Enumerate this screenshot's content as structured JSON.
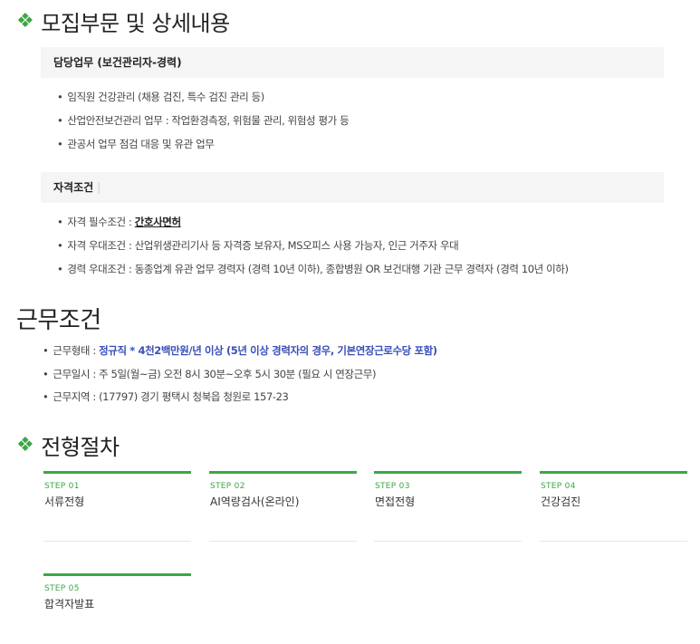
{
  "section_recruit": {
    "icon": "diamond-icon",
    "title": "모집부문 및 상세내용",
    "duty": {
      "header": "담당업무 (보건관리자-경력)",
      "items": [
        "임직원 건강관리 (채용 검진, 특수 검진 관리 등)",
        "산업안전보건관리 업무 : 작업환경측정, 위험물 관리, 위험성 평가 등",
        "관공서 업무 점검 대응 및 유관 업무"
      ]
    },
    "qualification": {
      "header": "자격조건",
      "required_label": "자격 필수조건 : ",
      "required_value": "간호사면허",
      "preferred": "자격 우대조건 : 산업위생관리기사 등 자격증 보유자, MS오피스 사용 가능자, 인근 거주자 우대",
      "career": "경력 우대조건 : 동종업계 유관 업무 경력자 (경력 10년 이하), 종합병원 OR 보건대행 기관 근무 경력자 (경력 10년 이하)"
    }
  },
  "section_conditions": {
    "title": "근무조건",
    "type_label": "근무형태 : ",
    "type_value": "정규직   *  4천2백만원/년 이상 (5년 이상 경력자의 경우, 기본연장근로수당 포함)",
    "schedule": "근무일시 : 주 5일(월~금) 오전 8시 30분~오후 5시 30분  (필요 시 연장근무)",
    "location": "근무지역 : (17797) 경기 평택시 청북읍 청원로 157-23"
  },
  "section_process": {
    "icon": "diamond-icon",
    "title": "전형절차",
    "steps": [
      {
        "num": "STEP 01",
        "name": "서류전형"
      },
      {
        "num": "STEP 02",
        "name": "AI역량검사(온라인)"
      },
      {
        "num": "STEP 03",
        "name": "면접전형"
      },
      {
        "num": "STEP 04",
        "name": "건강검진"
      },
      {
        "num": "STEP 05",
        "name": "합격자발표"
      }
    ]
  }
}
